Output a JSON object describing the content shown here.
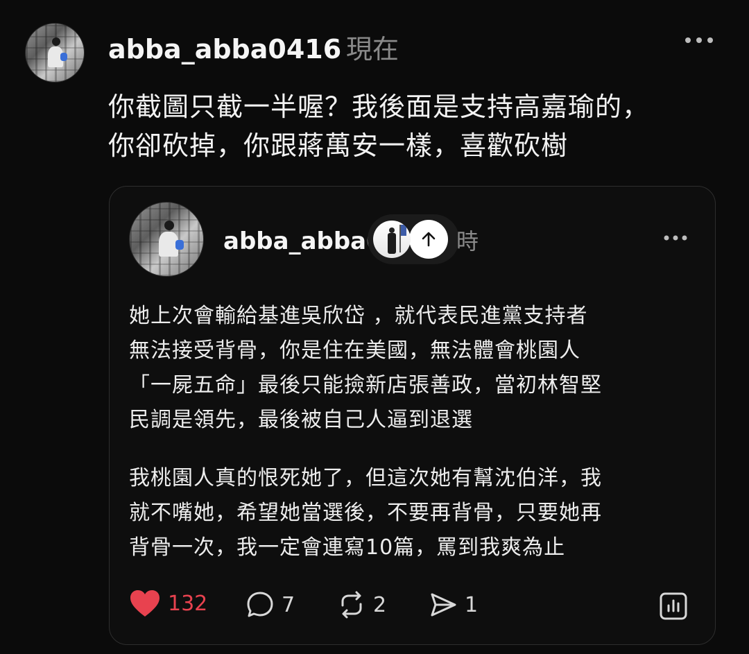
{
  "post": {
    "username": "abba_abba0416",
    "timestamp": "現在",
    "more_icon": "more-horizontal-icon",
    "text_lines": [
      "你截圖只截一半喔？我後面是支持高嘉瑜的，",
      "你卻砍掉，你跟蔣萬安一樣，喜歡砍樹"
    ]
  },
  "quoted": {
    "username": "abba_abba0",
    "timestamp_partial": "時",
    "scroll_up_icon": "arrow-up-icon",
    "more_icon": "more-horizontal-icon",
    "paragraph1": [
      "她上次會輸給基進吳欣岱 ，就代表民進黨支持者",
      "無法接受背骨，你是住在美國，無法體會桃園人",
      "「一屍五命」最後只能撿新店張善政，當初林智堅",
      "民調是領先，最後被自己人逼到退選"
    ],
    "paragraph2": [
      "我桃園人真的恨死她了，但這次她有幫沈伯洋，我",
      "就不嘴她，希望她當選後，不要再背骨，只要她再",
      "背骨一次，我一定會連寫10篇，罵到我爽為止"
    ],
    "stats": {
      "likes": "132",
      "comments": "7",
      "reposts": "2",
      "shares": "1"
    },
    "like_color": "#e8424f"
  }
}
